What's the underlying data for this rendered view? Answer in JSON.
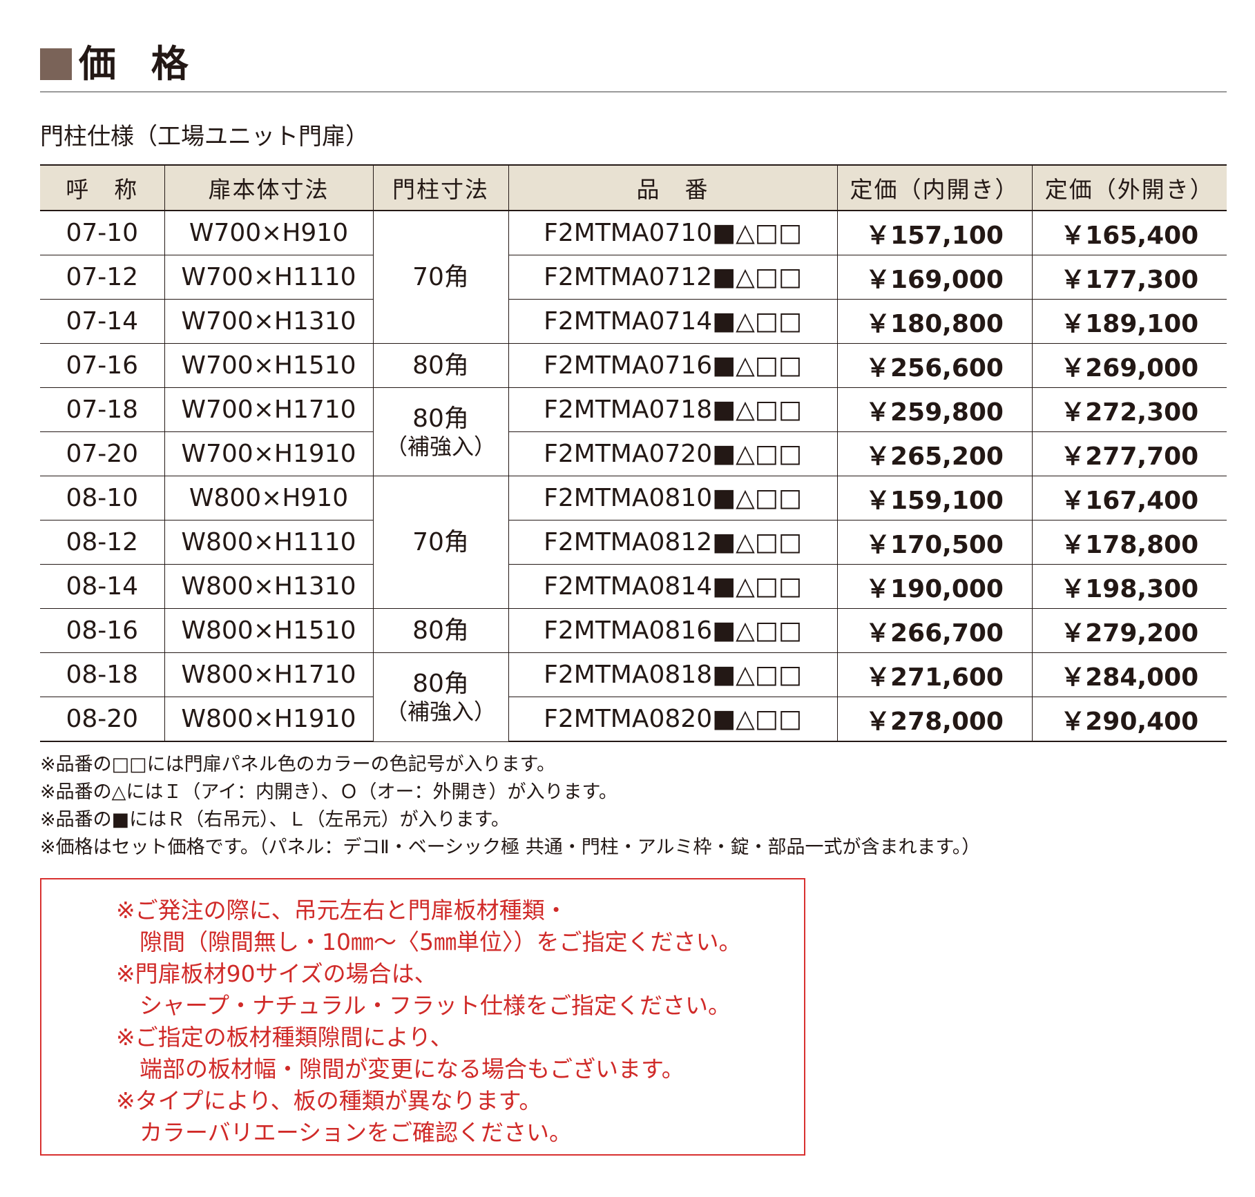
{
  "title": "価 格",
  "subtitle": "門柱仕様（工場ユニット門扉）",
  "table": {
    "headers": [
      "呼　称",
      "扉本体寸法",
      "門柱寸法",
      "品　番",
      "定価（内開き）",
      "定価（外開き）"
    ],
    "rows": [
      {
        "name": "07-10",
        "size": "W700×H910",
        "code": "F2MTMA0710■△□□",
        "price_in": "￥157,100",
        "price_out": "￥165,400"
      },
      {
        "name": "07-12",
        "size": "W700×H1110",
        "code": "F2MTMA0712■△□□",
        "price_in": "￥169,000",
        "price_out": "￥177,300"
      },
      {
        "name": "07-14",
        "size": "W700×H1310",
        "code": "F2MTMA0714■△□□",
        "price_in": "￥180,800",
        "price_out": "￥189,100"
      },
      {
        "name": "07-16",
        "size": "W700×H1510",
        "code": "F2MTMA0716■△□□",
        "price_in": "￥256,600",
        "price_out": "￥269,000"
      },
      {
        "name": "07-18",
        "size": "W700×H1710",
        "code": "F2MTMA0718■△□□",
        "price_in": "￥259,800",
        "price_out": "￥272,300"
      },
      {
        "name": "07-20",
        "size": "W700×H1910",
        "code": "F2MTMA0720■△□□",
        "price_in": "￥265,200",
        "price_out": "￥277,700"
      },
      {
        "name": "08-10",
        "size": "W800×H910",
        "code": "F2MTMA0810■△□□",
        "price_in": "￥159,100",
        "price_out": "￥167,400"
      },
      {
        "name": "08-12",
        "size": "W800×H1110",
        "code": "F2MTMA0812■△□□",
        "price_in": "￥170,500",
        "price_out": "￥178,800"
      },
      {
        "name": "08-14",
        "size": "W800×H1310",
        "code": "F2MTMA0814■△□□",
        "price_in": "￥190,000",
        "price_out": "￥198,300"
      },
      {
        "name": "08-16",
        "size": "W800×H1510",
        "code": "F2MTMA0816■△□□",
        "price_in": "￥266,700",
        "price_out": "￥279,200"
      },
      {
        "name": "08-18",
        "size": "W800×H1710",
        "code": "F2MTMA0818■△□□",
        "price_in": "￥271,600",
        "price_out": "￥284,000"
      },
      {
        "name": "08-20",
        "size": "W800×H1910",
        "code": "F2MTMA0820■△□□",
        "price_in": "￥278,000",
        "price_out": "￥290,400"
      }
    ],
    "posts": [
      {
        "label": "70角",
        "sub": ""
      },
      {
        "label": "80角",
        "sub": ""
      },
      {
        "label": "80角",
        "sub": "（補強入）"
      },
      {
        "label": "70角",
        "sub": ""
      },
      {
        "label": "80角",
        "sub": ""
      },
      {
        "label": "80角",
        "sub": "（補強入）"
      }
    ]
  },
  "notes": [
    "※品番の□□には門扉パネル色のカラーの色記号が入ります。",
    "※品番の△にはＩ（アイ：内開き）、Ｏ（オー：外開き）が入ります。",
    "※品番の■にはＲ（右吊元）、Ｌ（左吊元）が入ります。",
    "※価格はセット価格です。（パネル：デコⅡ・ベーシック極 共通・門柱・アルミ枠・錠・部品一式が含まれます。）"
  ],
  "notice": [
    "※ご発注の際に、吊元左右と門扉板材種類・",
    "隙間（隙間無し・10㎜〜〈5㎜単位〉）をご指定ください。",
    "※門扉板材90サイズの場合は、",
    "シャープ・ナチュラル・フラット仕様をご指定ください。",
    "※ご指定の板材種類隙間により、",
    "端部の板材幅・隙間が変更になる場合もございます。",
    "※タイプにより、板の種類が異なります。",
    "カラーバリエーションをご確認ください。"
  ],
  "colors": {
    "accent_square": "#7a6358",
    "header_bg": "#e8e1d2",
    "notice_red": "#d02a28"
  }
}
